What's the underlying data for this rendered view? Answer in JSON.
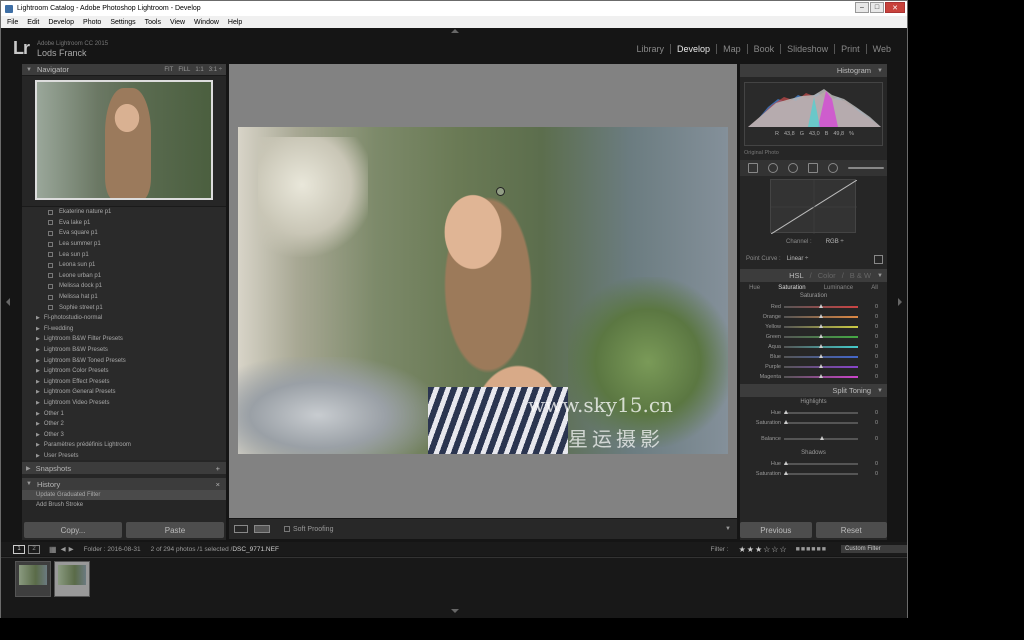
{
  "window": {
    "title": "Lightroom Catalog - Adobe Photoshop Lightroom - Develop"
  },
  "menu": [
    "File",
    "Edit",
    "Develop",
    "Photo",
    "Settings",
    "Tools",
    "View",
    "Window",
    "Help"
  ],
  "identity": {
    "product": "Adobe Lightroom CC 2015",
    "user": "Lods Franck"
  },
  "modules": [
    {
      "label": "Library",
      "active": false
    },
    {
      "label": "Develop",
      "active": true
    },
    {
      "label": "Map",
      "active": false
    },
    {
      "label": "Book",
      "active": false
    },
    {
      "label": "Slideshow",
      "active": false
    },
    {
      "label": "Print",
      "active": false
    },
    {
      "label": "Web",
      "active": false
    }
  ],
  "navigator": {
    "title": "Navigator",
    "zoom_options": [
      "FIT",
      "FILL",
      "1:1",
      "3:1 ÷"
    ]
  },
  "presets": {
    "items": [
      "Ekaterine nature p1",
      "Eva lake p1",
      "Eva square p1",
      "Lea summer p1",
      "Lea sun p1",
      "Leona sun p1",
      "Leone urban p1",
      "Melissa dock p1",
      "Melissa hat p1",
      "Sophie street p1"
    ],
    "folders": [
      "Fl-photostudio-normal",
      "Fl-wedding",
      "Lightroom B&W Filter Presets",
      "Lightroom B&W Presets",
      "Lightroom B&W Toned Presets",
      "Lightroom Color Presets",
      "Lightroom Effect Presets",
      "Lightroom General Presets",
      "Lightroom Video Presets",
      "Other 1",
      "Other 2",
      "Other 3",
      "Paramètres prédéfinis Lightroom",
      "User Presets"
    ]
  },
  "snapshots": {
    "title": "Snapshots",
    "add": "+"
  },
  "history": {
    "title": "History",
    "close": "×",
    "items": [
      "Update Graduated Filter",
      "Add Brush Stroke"
    ]
  },
  "left_buttons": {
    "copy": "Copy...",
    "paste": "Paste"
  },
  "image": {
    "watermark": "www.sky15.cn",
    "watermark_cn": "星运摄影"
  },
  "toolbar": {
    "soft_proofing": "Soft Proofing"
  },
  "histogram": {
    "title": "Histogram",
    "r_label": "R",
    "r": "43,8",
    "g_label": "G",
    "g": "43,0",
    "b_label": "B",
    "b": "49,8",
    "unit": "%",
    "original": "Original Photo"
  },
  "tone_curve": {
    "channel_label": "Channel :",
    "channel": "RGB ÷",
    "point_curve_label": "Point Curve :",
    "point_curve": "Linear ÷"
  },
  "hsl": {
    "tabs_head": [
      "HSL",
      "Color",
      "B & W"
    ],
    "tabs": [
      "Hue",
      "Saturation",
      "Luminance",
      "All"
    ],
    "section": "Saturation",
    "rows": [
      {
        "label": "Red",
        "value": "0",
        "pos": 0.5
      },
      {
        "label": "Orange",
        "value": "0",
        "pos": 0.5
      },
      {
        "label": "Yellow",
        "value": "0",
        "pos": 0.5
      },
      {
        "label": "Green",
        "value": "0",
        "pos": 0.5
      },
      {
        "label": "Aqua",
        "value": "0",
        "pos": 0.5
      },
      {
        "label": "Blue",
        "value": "0",
        "pos": 0.5
      },
      {
        "label": "Purple",
        "value": "0",
        "pos": 0.5
      },
      {
        "label": "Magenta",
        "value": "0",
        "pos": 0.5
      }
    ]
  },
  "split_toning": {
    "title": "Split Toning",
    "highlights": "Highlights",
    "shadows": "Shadows",
    "balance": "Balance",
    "hue": "Hue",
    "saturation": "Saturation",
    "zero": "0"
  },
  "right_buttons": {
    "previous": "Previous",
    "reset": "Reset"
  },
  "filmbar": {
    "page1": "1",
    "page2": "2",
    "folder": "Folder : 2016-08-31",
    "count": "2 of 294 photos /1 selected /",
    "file": "DSC_9771.NEF",
    "filter_label": "Filter :",
    "custom_filter": "Custom Filter"
  }
}
